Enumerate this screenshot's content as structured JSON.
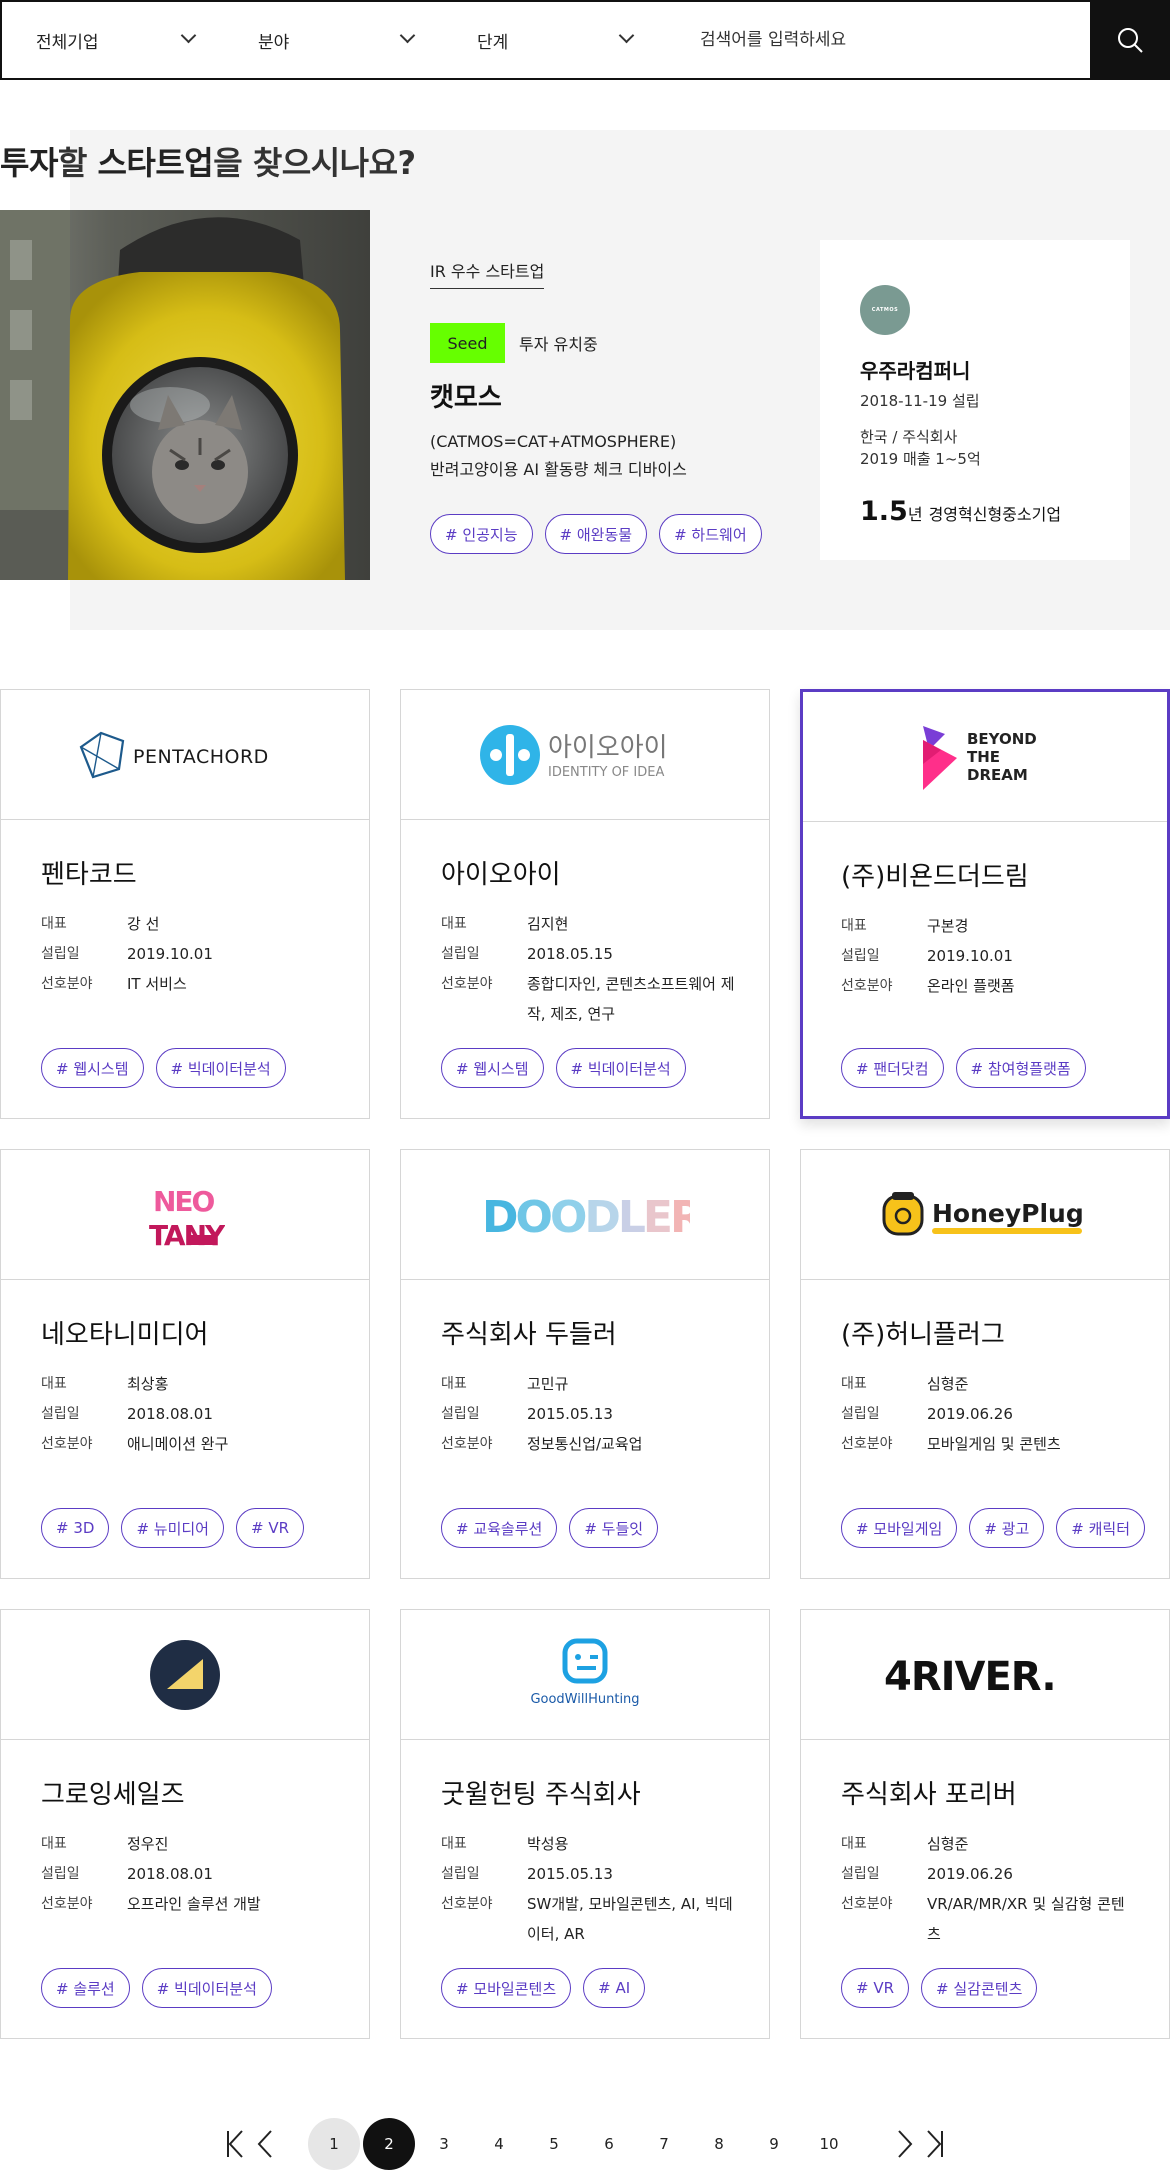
{
  "search": {
    "filter_company": "전체기업",
    "filter_field": "분야",
    "filter_stage": "단계",
    "placeholder": "검색어를 입력하세요"
  },
  "hero": {
    "title_bold1": "투자",
    "title_mid": "할 ",
    "title_bold2": "스타트업",
    "title_end": "을 찾으시나요?",
    "label": "IR 우수 스타트업",
    "stage": "Seed",
    "stage_status": "투자 유치중",
    "name": "캣모스",
    "desc_line1": "(CATMOS=CAT+ATMOSPHERE)",
    "desc_line2": "반려고양이용 AI 활동량 체크 디바이스",
    "tags": [
      "# 인공지능",
      "# 애완동물",
      "# 하드웨어"
    ],
    "card": {
      "logo_text": "CATMOS",
      "company": "우주라컴퍼니",
      "founded": "2018-11-19 설립",
      "country_type": "한국 / 주식회사",
      "revenue": "2019 매출 1~5억",
      "years": "1.5",
      "years_suffix": "년",
      "category": "경영혁신형중소기업"
    }
  },
  "labels": {
    "ceo": "대표",
    "founded": "설립일",
    "field": "선호분야"
  },
  "companies": [
    {
      "name": "펜타코드",
      "ceo": "강 선",
      "founded": "2019.10.01",
      "field": "IT 서비스",
      "tags": [
        "# 웹시스템",
        "# 빅데이터분석"
      ],
      "logo": "PENTACHORD"
    },
    {
      "name": "아이오아이",
      "ceo": "김지현",
      "founded": "2018.05.15",
      "field": "종합디자인, 콘텐츠소프트웨어 제작, 제조, 연구",
      "tags": [
        "# 웹시스템",
        "# 빅데이터분석"
      ],
      "logo": "아이오아이",
      "logo_sub": "IDENTITY OF IDEA"
    },
    {
      "name": "(주)비욘드더드림",
      "ceo": "구본경",
      "founded": "2019.10.01",
      "field": "온라인 플랫폼",
      "tags": [
        "# 팬더닷컴",
        "# 참여형플랫폼"
      ],
      "logo": "BEYOND THE DREAM",
      "active": true
    },
    {
      "name": "네오타니미디어",
      "ceo": "최상홍",
      "founded": "2018.08.01",
      "field": "애니메이션 완구",
      "tags": [
        "# 3D",
        "# 뉴미디어",
        "# VR"
      ],
      "logo": "NEO TANY"
    },
    {
      "name": "주식회사 두들러",
      "ceo": "고민규",
      "founded": "2015.05.13",
      "field": "정보통신업/교육업",
      "tags": [
        "# 교육솔루션",
        "# 두들잇"
      ],
      "logo": "DOODLER"
    },
    {
      "name": "(주)허니플러그",
      "ceo": "심형준",
      "founded": "2019.06.26",
      "field": "모바일게임 및 콘텐츠",
      "tags": [
        "# 모바일게임",
        "# 광고",
        "# 캐릭터"
      ],
      "logo": "HoneyPlug"
    },
    {
      "name": "그로잉세일즈",
      "ceo": "정우진",
      "founded": "2018.08.01",
      "field": "오프라인 솔루션 개발",
      "tags": [
        "# 솔루션",
        "# 빅데이터분석"
      ],
      "logo": ""
    },
    {
      "name": "굿윌헌팅 주식회사",
      "ceo": "박성용",
      "founded": "2015.05.13",
      "field": "SW개발, 모바일콘텐츠, AI, 빅데이터, AR",
      "tags": [
        "# 모바일콘텐츠",
        "# AI"
      ],
      "logo": "GoodWillHunting"
    },
    {
      "name": "주식회사 포리버",
      "ceo": "심형준",
      "founded": "2019.06.26",
      "field": "VR/AR/MR/XR 및 실감형 콘텐츠",
      "tags": [
        "# VR",
        "# 실감콘텐츠"
      ],
      "logo": "4RIVER."
    }
  ],
  "pagination": {
    "pages": [
      "1",
      "2",
      "3",
      "4",
      "5",
      "6",
      "7",
      "8",
      "9",
      "10"
    ],
    "current": "2"
  },
  "colors": {
    "accent": "#5b3cc4",
    "seed": "#66ff00",
    "dark": "#111111"
  }
}
